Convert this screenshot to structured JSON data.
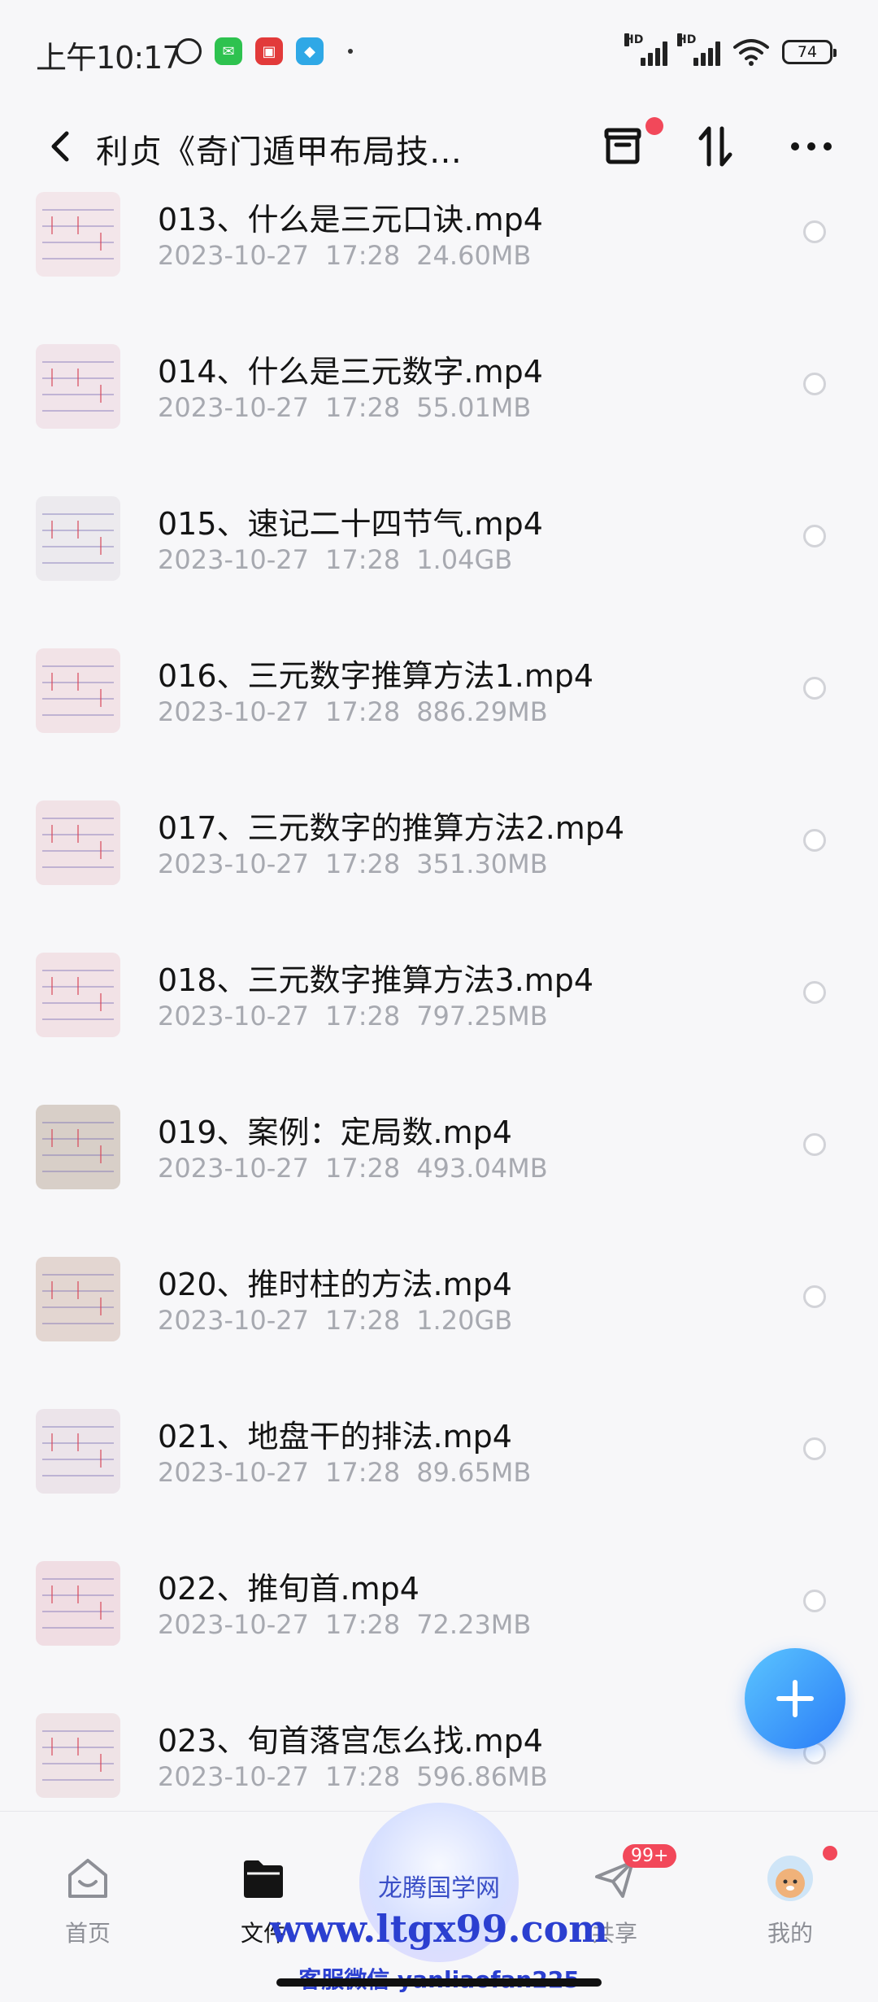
{
  "status": {
    "time": "上午10:17",
    "signal_label": "HD",
    "battery": "74",
    "apps": [
      {
        "name": "wechat",
        "color": "#2ec24f"
      },
      {
        "name": "red-app",
        "color": "#e23a3a"
      },
      {
        "name": "blue-app",
        "color": "#2fa8e6"
      }
    ]
  },
  "header": {
    "title": "利贞《奇门遁甲布局技…",
    "back_icon": "chevron-left-icon",
    "archive_icon": "archive-box-icon",
    "sort_icon": "sort-arrows-icon",
    "more_icon": "more-dots-icon"
  },
  "files": [
    {
      "name": "013、什么是三元口诀.mp4",
      "date": "2023-10-27",
      "time": "17:28",
      "size": "24.60MB",
      "thumb": "#f3e6ea"
    },
    {
      "name": "014、什么是三元数字.mp4",
      "date": "2023-10-27",
      "time": "17:28",
      "size": "55.01MB",
      "thumb": "#f1e4ea"
    },
    {
      "name": "015、速记二十四节气.mp4",
      "date": "2023-10-27",
      "time": "17:28",
      "size": "1.04GB",
      "thumb": "#eceaee"
    },
    {
      "name": "016、三元数字推算方法1.mp4",
      "date": "2023-10-27",
      "time": "17:28",
      "size": "886.29MB",
      "thumb": "#f2e3e7"
    },
    {
      "name": "017、三元数字的推算方法2.mp4",
      "date": "2023-10-27",
      "time": "17:28",
      "size": "351.30MB",
      "thumb": "#f1e2e6"
    },
    {
      "name": "018、三元数字推算方法3.mp4",
      "date": "2023-10-27",
      "time": "17:28",
      "size": "797.25MB",
      "thumb": "#f2e2e6"
    },
    {
      "name": "019、案例：定局数.mp4",
      "date": "2023-10-27",
      "time": "17:28",
      "size": "493.04MB",
      "thumb": "#d8cfc8"
    },
    {
      "name": "020、推时柱的方法.mp4",
      "date": "2023-10-27",
      "time": "17:28",
      "size": "1.20GB",
      "thumb": "#e3d6d1"
    },
    {
      "name": "021、地盘干的排法.mp4",
      "date": "2023-10-27",
      "time": "17:28",
      "size": "89.65MB",
      "thumb": "#ece4ea"
    },
    {
      "name": "022、推旬首.mp4",
      "date": "2023-10-27",
      "time": "17:28",
      "size": "72.23MB",
      "thumb": "#f0dde3"
    },
    {
      "name": "023、旬首落宫怎么找.mp4",
      "date": "2023-10-27",
      "time": "17:28",
      "size": "596.86MB",
      "thumb": "#efe3e6"
    }
  ],
  "fab": {
    "icon": "plus-icon"
  },
  "nav": [
    {
      "label": "首页",
      "icon": "home-icon",
      "active": false
    },
    {
      "label": "文件",
      "icon": "folder-icon",
      "active": true
    },
    {
      "label": "",
      "icon": "",
      "active": false
    },
    {
      "label": "共享",
      "icon": "send-icon",
      "active": false,
      "badge": "99+"
    },
    {
      "label": "我的",
      "icon": "avatar-icon",
      "active": false
    }
  ],
  "watermark": {
    "title": "龙腾国学网",
    "url": "www.ltgx99.com",
    "wechat": "客服微信 yanliaofan225"
  },
  "colors": {
    "accent": "#2a7cf7",
    "badge": "#f2485a",
    "meta": "#a7a9b0"
  }
}
